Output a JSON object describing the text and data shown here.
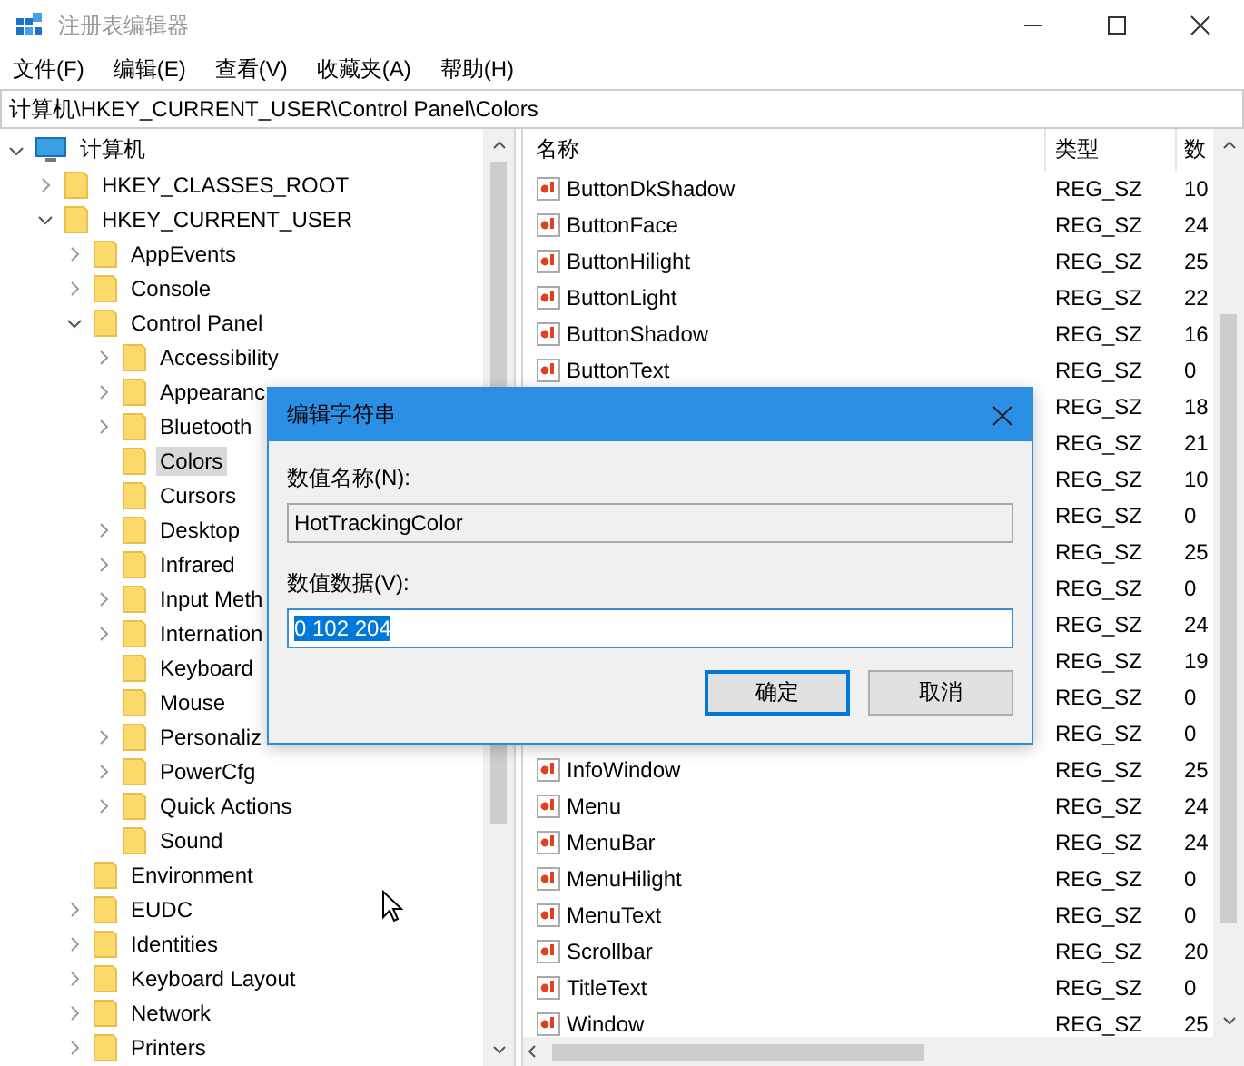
{
  "window": {
    "title": "注册表编辑器"
  },
  "menu": [
    {
      "label": "文件(F)"
    },
    {
      "label": "编辑(E)"
    },
    {
      "label": "查看(V)"
    },
    {
      "label": "收藏夹(A)"
    },
    {
      "label": "帮助(H)"
    }
  ],
  "address": "计算机\\HKEY_CURRENT_USER\\Control Panel\\Colors",
  "tree": {
    "label": "计算机",
    "kind": "computer",
    "expandable": true,
    "expanded": true,
    "selected": false,
    "children": [
      {
        "label": "HKEY_CLASSES_ROOT",
        "expandable": true,
        "expanded": false,
        "selected": false
      },
      {
        "label": "HKEY_CURRENT_USER",
        "expandable": true,
        "expanded": true,
        "selected": false,
        "children": [
          {
            "label": "AppEvents",
            "expandable": true,
            "expanded": false,
            "selected": false
          },
          {
            "label": "Console",
            "expandable": true,
            "expanded": false,
            "selected": false
          },
          {
            "label": "Control Panel",
            "expandable": true,
            "expanded": true,
            "selected": false,
            "children": [
              {
                "label": "Accessibility",
                "expandable": true,
                "expanded": false,
                "selected": false
              },
              {
                "label": "Appearanc",
                "expandable": true,
                "expanded": false,
                "selected": false
              },
              {
                "label": "Bluetooth",
                "expandable": true,
                "expanded": false,
                "selected": false
              },
              {
                "label": "Colors",
                "expandable": false,
                "selected": true
              },
              {
                "label": "Cursors",
                "expandable": false,
                "selected": false
              },
              {
                "label": "Desktop",
                "expandable": true,
                "expanded": false,
                "selected": false
              },
              {
                "label": "Infrared",
                "expandable": true,
                "expanded": false,
                "selected": false
              },
              {
                "label": "Input Meth",
                "expandable": true,
                "expanded": false,
                "selected": false
              },
              {
                "label": "Internation",
                "expandable": true,
                "expanded": false,
                "selected": false
              },
              {
                "label": "Keyboard",
                "expandable": false,
                "selected": false
              },
              {
                "label": "Mouse",
                "expandable": false,
                "selected": false
              },
              {
                "label": "Personaliz",
                "expandable": true,
                "expanded": false,
                "selected": false
              },
              {
                "label": "PowerCfg",
                "expandable": true,
                "expanded": false,
                "selected": false
              },
              {
                "label": "Quick Actions",
                "expandable": true,
                "expanded": false,
                "selected": false
              },
              {
                "label": "Sound",
                "expandable": false,
                "selected": false
              }
            ]
          },
          {
            "label": "Environment",
            "expandable": false,
            "selected": false
          },
          {
            "label": "EUDC",
            "expandable": true,
            "expanded": false,
            "selected": false
          },
          {
            "label": "Identities",
            "expandable": true,
            "expanded": false,
            "selected": false
          },
          {
            "label": "Keyboard Layout",
            "expandable": true,
            "expanded": false,
            "selected": false
          },
          {
            "label": "Network",
            "expandable": true,
            "expanded": false,
            "selected": false
          },
          {
            "label": "Printers",
            "expandable": true,
            "expanded": false,
            "selected": false
          }
        ]
      }
    ]
  },
  "table": {
    "columns": [
      "名称",
      "类型",
      "数"
    ],
    "rows": [
      {
        "name": "ButtonDkShadow",
        "type": "REG_SZ",
        "data": "10"
      },
      {
        "name": "ButtonFace",
        "type": "REG_SZ",
        "data": "24"
      },
      {
        "name": "ButtonHilight",
        "type": "REG_SZ",
        "data": "25"
      },
      {
        "name": "ButtonLight",
        "type": "REG_SZ",
        "data": "22"
      },
      {
        "name": "ButtonShadow",
        "type": "REG_SZ",
        "data": "16"
      },
      {
        "name": "ButtonText",
        "type": "REG_SZ",
        "data": "0"
      },
      {
        "type": "REG_SZ",
        "data": "18"
      },
      {
        "type": "REG_SZ",
        "data": "21"
      },
      {
        "type": "REG_SZ",
        "data": "10"
      },
      {
        "type": "REG_SZ",
        "data": "0"
      },
      {
        "type": "REG_SZ",
        "data": "25"
      },
      {
        "type": "REG_SZ",
        "data": "0"
      },
      {
        "type": "REG_SZ",
        "data": "24"
      },
      {
        "type": "REG_SZ",
        "data": "19"
      },
      {
        "type": "REG_SZ",
        "data": "0"
      },
      {
        "type": "REG_SZ",
        "data": "0"
      },
      {
        "name": "InfoWindow",
        "type": "REG_SZ",
        "data": "25"
      },
      {
        "name": "Menu",
        "type": "REG_SZ",
        "data": "24"
      },
      {
        "name": "MenuBar",
        "type": "REG_SZ",
        "data": "24"
      },
      {
        "name": "MenuHilight",
        "type": "REG_SZ",
        "data": "0"
      },
      {
        "name": "MenuText",
        "type": "REG_SZ",
        "data": "0"
      },
      {
        "name": "Scrollbar",
        "type": "REG_SZ",
        "data": "20"
      },
      {
        "name": "TitleText",
        "type": "REG_SZ",
        "data": "0"
      },
      {
        "name": "Window",
        "type": "REG_SZ",
        "data": "25"
      }
    ]
  },
  "dialog": {
    "title": "编辑字符串",
    "name_label": "数值名称(N):",
    "name_value": "HotTrackingColor",
    "data_label": "数值数据(V):",
    "data_value": "0 102 204",
    "data_selected": true,
    "buttons": [
      {
        "label": "确定",
        "default": true
      },
      {
        "label": "取消",
        "default": false
      }
    ]
  }
}
